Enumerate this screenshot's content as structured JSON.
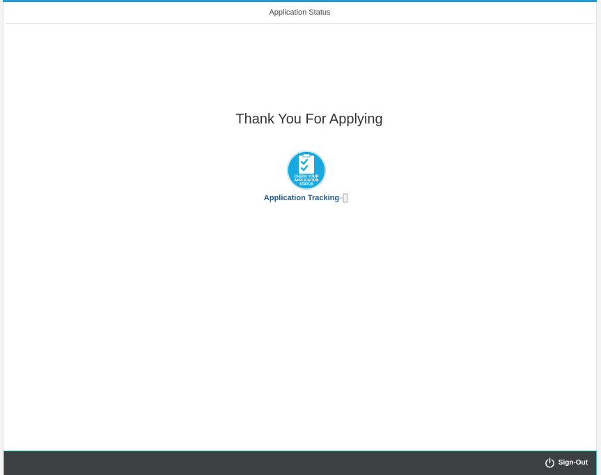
{
  "header": {
    "title": "Application Status"
  },
  "main": {
    "heading": "Thank You For Applying",
    "tracking": {
      "badge_text": [
        "CHECK YOUR",
        "APPLICATION",
        "STATUS"
      ],
      "label": "Application Tracking",
      "badge_icon": "clipboard-check-icon",
      "external_icon": "external-link-icon"
    }
  },
  "footer": {
    "signout_label": "Sign-Out",
    "signout_icon": "power-icon"
  },
  "colors": {
    "accent": "#1d9bd8",
    "badge": "#19a9e1",
    "link": "#1f5a94",
    "footer_bg": "#3c4043",
    "footer_border": "#2fc5b4"
  }
}
